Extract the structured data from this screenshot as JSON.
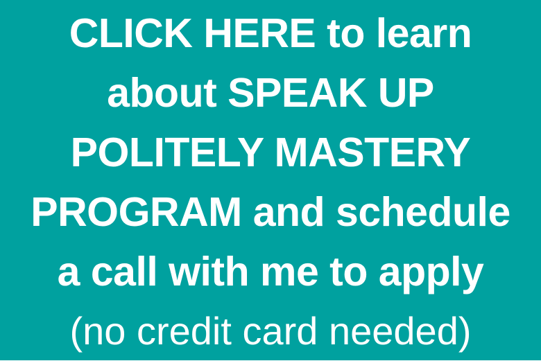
{
  "banner": {
    "background_color": "#00a19f",
    "text_color": "#ffffff",
    "lines": [
      "CLICK HERE to learn",
      "about SPEAK UP",
      "POLITELY MASTERY",
      "PROGRAM and schedule",
      "a call with me to apply"
    ],
    "note": "(no credit card needed)"
  }
}
